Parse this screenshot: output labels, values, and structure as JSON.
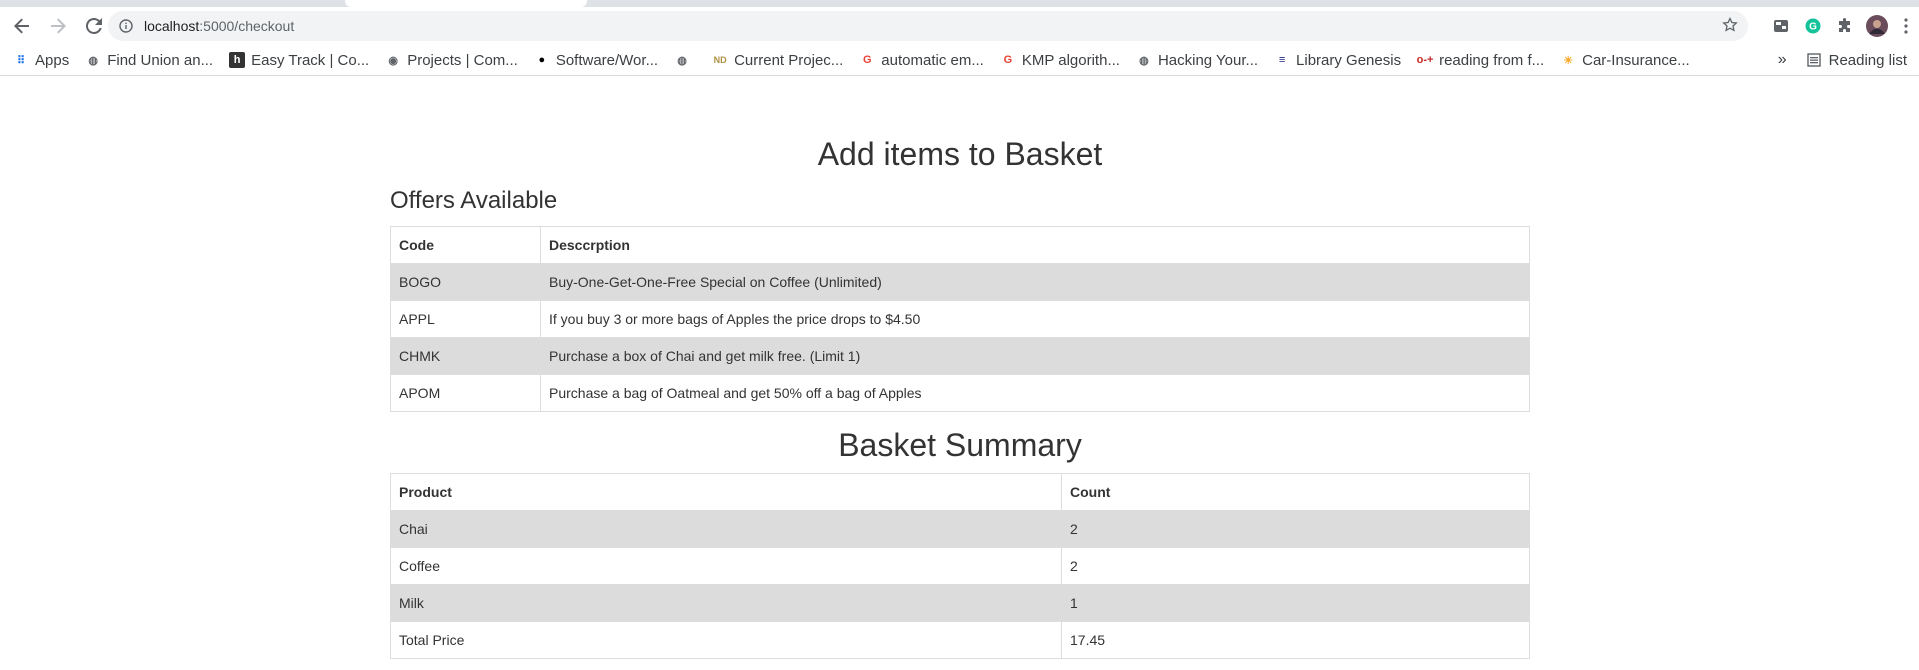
{
  "browser": {
    "url_host": "localhost",
    "url_path": ":5000/checkout",
    "bookmarks": [
      {
        "label": "Apps",
        "icon": "apps-grid-icon",
        "color": "#1a73e8"
      },
      {
        "label": "Find Union an...",
        "icon": "globe-icon",
        "color": "#5f6368"
      },
      {
        "label": "Easy Track | Co...",
        "icon": "h-logo-icon",
        "color": "#333333"
      },
      {
        "label": "Projects | Com...",
        "icon": "location-icon",
        "color": "#5f6368"
      },
      {
        "label": "Software/Wor...",
        "icon": "github-icon",
        "color": "#000000"
      },
      {
        "label": "",
        "icon": "globe-icon",
        "color": "#5f6368"
      },
      {
        "label": "Current Projec...",
        "icon": "nd-logo-icon",
        "color": "#ae9142"
      },
      {
        "label": "automatic em...",
        "icon": "google-icon",
        "color": "#ea4335"
      },
      {
        "label": "KMP algorith...",
        "icon": "google-icon",
        "color": "#ea4335"
      },
      {
        "label": "Hacking Your...",
        "icon": "globe-icon",
        "color": "#5f6368"
      },
      {
        "label": "Library Genesis",
        "icon": "libgen-icon",
        "color": "#1a237e"
      },
      {
        "label": "reading from f...",
        "icon": "key-icon",
        "color": "#c62828"
      },
      {
        "label": "Car-Insurance...",
        "icon": "bulb-icon",
        "color": "#f9a825"
      }
    ],
    "reading_list": "Reading list"
  },
  "page": {
    "title": "Add items to Basket",
    "offers_heading": "Offers Available",
    "offers_headers": [
      "Code",
      "Desccrption"
    ],
    "offers": [
      {
        "code": "BOGO",
        "desc": "Buy-One-Get-One-Free Special on Coffee (Unlimited)"
      },
      {
        "code": "APPL",
        "desc": "If you buy 3 or more bags of Apples the price drops to $4.50"
      },
      {
        "code": "CHMK",
        "desc": "Purchase a box of Chai and get milk free. (Limit 1)"
      },
      {
        "code": "APOM",
        "desc": "Purchase a bag of Oatmeal and get 50% off a bag of Apples"
      }
    ],
    "summary_heading": "Basket Summary",
    "summary_headers": [
      "Product",
      "Count"
    ],
    "summary": [
      {
        "product": "Chai",
        "count": "2"
      },
      {
        "product": "Coffee",
        "count": "2"
      },
      {
        "product": "Milk",
        "count": "1"
      },
      {
        "product": "Total Price",
        "count": "17.45"
      }
    ]
  }
}
